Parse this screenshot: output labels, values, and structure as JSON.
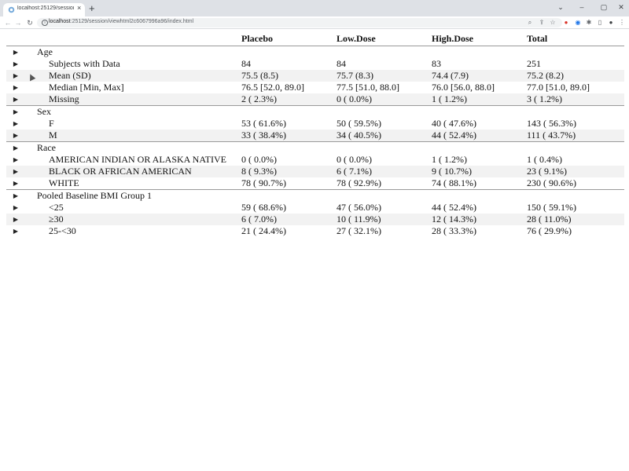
{
  "browser": {
    "tab_title": "localhost:25129/session/viewhtm",
    "tab_close": "×",
    "new_tab": "+",
    "url_host": "localhost",
    "url_path": ":25129/session/viewhtml2c6067996a96/index.html",
    "window_controls": [
      "⌄",
      "–",
      "▢",
      "✕"
    ]
  },
  "table": {
    "headers": [
      "",
      "Placebo",
      "Low.Dose",
      "High.Dose",
      "Total"
    ],
    "rows": [
      {
        "label": "Age",
        "level": 0,
        "group": true,
        "values": [
          "",
          "",
          "",
          ""
        ]
      },
      {
        "label": "Subjects with Data",
        "level": 1,
        "values": [
          "84",
          "84",
          "83",
          "251"
        ]
      },
      {
        "label": "Mean (SD)",
        "level": 1,
        "values": [
          "75.5 (8.5)",
          "75.7 (8.3)",
          "74.4 (7.9)",
          "75.2 (8.2)"
        ]
      },
      {
        "label": "Median [Min, Max]",
        "level": 1,
        "values": [
          "76.5 [52.0, 89.0]",
          "77.5 [51.0, 88.0]",
          "76.0 [56.0, 88.0]",
          "77.0 [51.0, 89.0]"
        ]
      },
      {
        "label": "Missing",
        "level": 1,
        "values": [
          "2 ( 2.3%)",
          "0 ( 0.0%)",
          "1 ( 1.2%)",
          "3 ( 1.2%)"
        ]
      },
      {
        "label": "Sex",
        "level": 0,
        "group": true,
        "values": [
          "",
          "",
          "",
          ""
        ]
      },
      {
        "label": "F",
        "level": 1,
        "values": [
          "53 ( 61.6%)",
          "50 ( 59.5%)",
          "40 ( 47.6%)",
          "143 ( 56.3%)"
        ]
      },
      {
        "label": "M",
        "level": 1,
        "values": [
          "33 ( 38.4%)",
          "34 ( 40.5%)",
          "44 ( 52.4%)",
          "111 ( 43.7%)"
        ]
      },
      {
        "label": "Race",
        "level": 0,
        "group": true,
        "values": [
          "",
          "",
          "",
          ""
        ]
      },
      {
        "label": "AMERICAN INDIAN OR ALASKA NATIVE",
        "level": 1,
        "values": [
          "0 ( 0.0%)",
          "0 ( 0.0%)",
          "1 ( 1.2%)",
          "1 ( 0.4%)"
        ]
      },
      {
        "label": "BLACK OR AFRICAN AMERICAN",
        "level": 1,
        "values": [
          "8 ( 9.3%)",
          "6 ( 7.1%)",
          "9 ( 10.7%)",
          "23 ( 9.1%)"
        ]
      },
      {
        "label": "WHITE",
        "level": 1,
        "values": [
          "78 ( 90.7%)",
          "78 ( 92.9%)",
          "74 ( 88.1%)",
          "230 ( 90.6%)"
        ]
      },
      {
        "label": "Pooled Baseline BMI Group 1",
        "level": 0,
        "group": true,
        "values": [
          "",
          "",
          "",
          ""
        ]
      },
      {
        "label": "<25",
        "level": 1,
        "values": [
          "59 ( 68.6%)",
          "47 ( 56.0%)",
          "44 ( 52.4%)",
          "150 ( 59.1%)"
        ]
      },
      {
        "label": "≥30",
        "level": 1,
        "values": [
          "6 ( 7.0%)",
          "10 ( 11.9%)",
          "12 ( 14.3%)",
          "28 ( 11.0%)"
        ]
      },
      {
        "label": "25-<30",
        "level": 1,
        "values": [
          "21 ( 24.4%)",
          "27 ( 32.1%)",
          "28 ( 33.3%)",
          "76 ( 29.9%)"
        ]
      }
    ]
  },
  "colors": {
    "tabstrip": "#dee1e6",
    "stripe": "#f2f2f2",
    "rule": "#9a9a9a"
  }
}
